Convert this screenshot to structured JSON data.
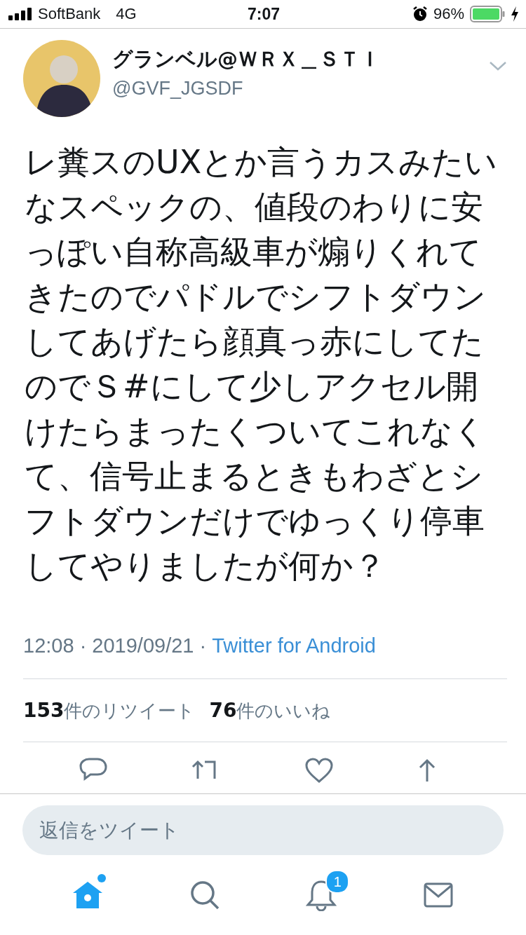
{
  "status_bar": {
    "carrier": "SoftBank",
    "network": "4G",
    "time": "7:07",
    "battery": "96%"
  },
  "tweet": {
    "name": "グランベル@ＷＲＸ＿ＳＴＩ",
    "handle": "@GVF_JGSDF",
    "text": "レ糞スのUXとか言うカスみたいなスペックの、値段のわりに安っぽい自称高級車が煽りくれてきたのでパドルでシフトダウンしてあげたら顔真っ赤にしてたのでＳ#にして少しアクセル開けたらまったくついてこれなくて、信号止まるときもわざとシフトダウンだけでゆっくり停車してやりましたが何か？",
    "timestamp": "12:08 · 2019/09/21 ·",
    "source": "Twitter for Android",
    "stats": [
      "**153**件のリツイート",
      "**76**件のいいね"
    ]
  },
  "reply": {
    "placeholder": "返信をツイート"
  },
  "tabs": [
    {
      "kind": "home",
      "selected": true,
      "dot": true
    },
    {
      "kind": "search",
      "selected": false,
      "dot": false
    },
    {
      "kind": "notifications",
      "selected": false,
      "dot": false,
      "badge": "1"
    },
    {
      "kind": "messages",
      "selected": false,
      "dot": false
    }
  ]
}
